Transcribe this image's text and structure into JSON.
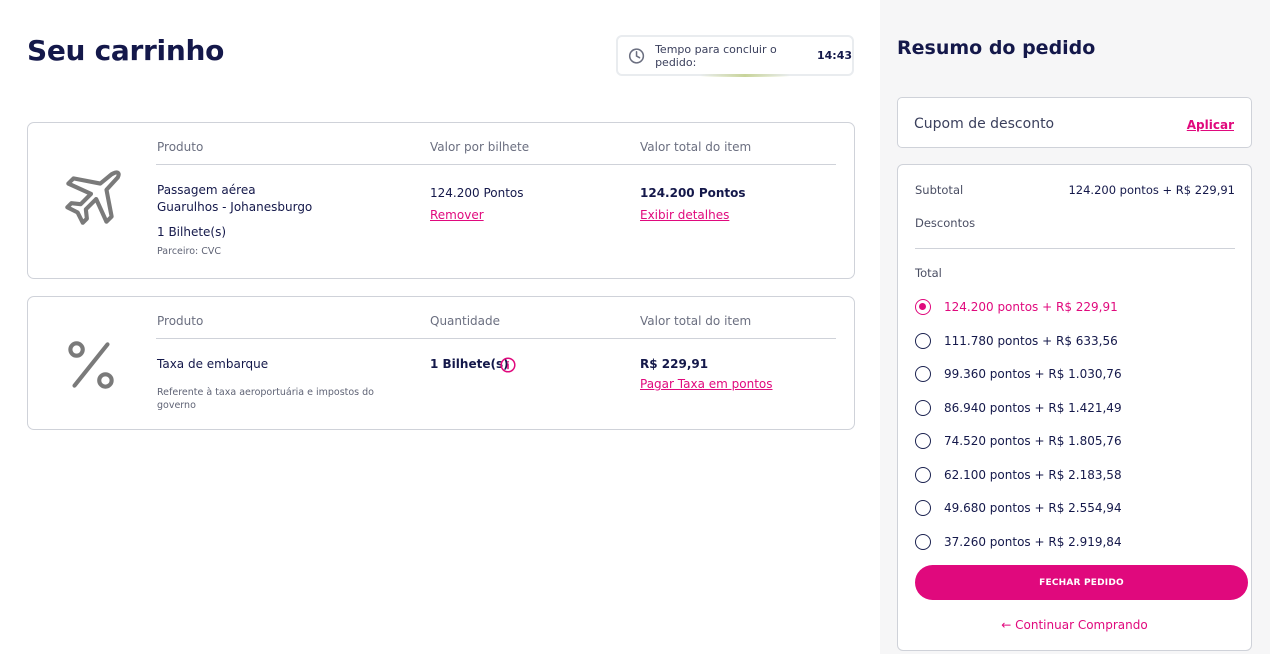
{
  "page": {
    "title": "Seu carrinho"
  },
  "timer": {
    "label": "Tempo para concluir o pedido:",
    "time": "14:43"
  },
  "cart": {
    "flight": {
      "headers": [
        "Produto",
        "Valor por bilhete",
        "Valor total do item"
      ],
      "product_name": "Passagem aérea",
      "route": "Guarulhos - Johanesburgo",
      "tickets": "1 Bilhete(s)",
      "partner": "Parceiro: CVC",
      "price_per_ticket": "124.200 Pontos",
      "remove_label": "Remover",
      "total": "124.200 Pontos",
      "details_label": "Exibir detalhes",
      "icon": "airplane-icon"
    },
    "tax": {
      "headers": [
        "Produto",
        "Quantidade",
        "Valor total do item"
      ],
      "product_name": "Taxa de embarque",
      "description": "Referente à taxa aeroportuária e impostos do governo",
      "quantity": "1 Bilhete(s)",
      "total": "R$ 229,91",
      "pay_points_label": "Pagar Taxa em pontos",
      "icon": "percent-icon"
    }
  },
  "summary": {
    "title": "Resumo do pedido",
    "coupon_label": "Cupom de desconto",
    "coupon_apply": "Aplicar",
    "subtotal_label": "Subtotal",
    "subtotal_value": "124.200 pontos + R$ 229,91",
    "discounts_label": "Descontos",
    "total_label": "Total",
    "options": [
      {
        "label": "124.200 pontos + R$ 229,91",
        "selected": true
      },
      {
        "label": "111.780 pontos + R$ 633,56",
        "selected": false
      },
      {
        "label": "99.360 pontos + R$ 1.030,76",
        "selected": false
      },
      {
        "label": "86.940 pontos + R$ 1.421,49",
        "selected": false
      },
      {
        "label": "74.520 pontos + R$ 1.805,76",
        "selected": false
      },
      {
        "label": "62.100 pontos + R$ 2.183,58",
        "selected": false
      },
      {
        "label": "49.680 pontos + R$ 2.554,94",
        "selected": false
      },
      {
        "label": "37.260 pontos + R$ 2.919,84",
        "selected": false
      }
    ],
    "checkout_label": "FECHAR PEDIDO",
    "continue_label": "← Continuar Comprando"
  },
  "colors": {
    "accent": "#e0097d",
    "text": "#14184a",
    "border": "#cfd2d9",
    "sidebar_bg": "#f6f6f7"
  }
}
